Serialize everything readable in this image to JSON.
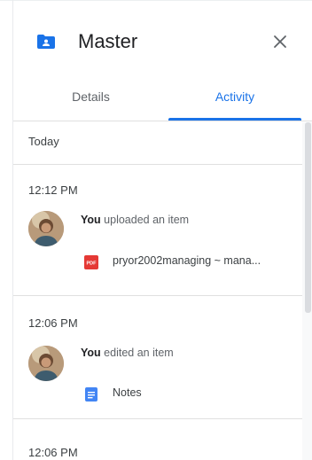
{
  "panel": {
    "title": "Master",
    "folder_icon": "shared-folder-icon",
    "close_icon": "close-icon"
  },
  "tabs": [
    {
      "label": "Details",
      "selected": false
    },
    {
      "label": "Activity",
      "selected": true
    }
  ],
  "colors": {
    "accent": "#1a73e8",
    "pdf_red": "#e53935",
    "docs_blue": "#4285f4"
  },
  "activity": {
    "day_label": "Today",
    "entries": [
      {
        "time": "12:12 PM",
        "actor": "You",
        "action": "uploaded an item",
        "file": {
          "name": "pryor2002managing ~ mana...",
          "icon": "pdf-file-icon"
        }
      },
      {
        "time": "12:06 PM",
        "actor": "You",
        "action": "edited an item",
        "file": {
          "name": "Notes",
          "icon": "google-docs-icon"
        }
      },
      {
        "time": "12:06 PM"
      }
    ]
  }
}
